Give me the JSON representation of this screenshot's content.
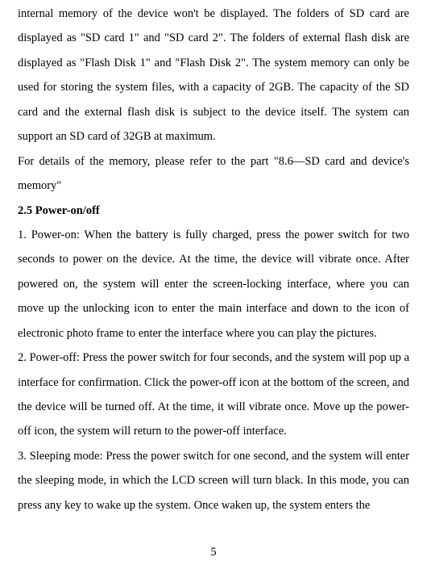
{
  "paragraphs": {
    "p1": "internal memory of the device won't be displayed. The folders of SD card are displayed as \"SD card 1\" and \"SD card 2\". The folders of external flash disk are displayed as \"Flash Disk 1\" and \"Flash Disk 2\". The system memory can only be used for storing the system files, with a capacity of 2GB. The capacity of the SD card and the external flash disk is subject to the device itself. The system can support an SD card of 32GB at maximum.",
    "p2": "For details of the memory, please refer to the part \"8.6—SD card and device's memory\"",
    "heading": "2.5 Power-on/off",
    "p3": "1. Power-on: When the battery is fully charged, press the power switch for two seconds to power on the device. At the time, the device will vibrate once. After powered on, the system will enter the screen-locking interface, where you can move up the unlocking icon to enter the main interface and down to the icon of electronic photo frame to enter the interface where you can play the pictures.",
    "p4": "2. Power-off: Press the power switch for four seconds, and the system will pop up a interface for confirmation. Click the power-off icon at the bottom of the screen, and the device will be turned off. At the time, it will vibrate once. Move up the power-off icon, the system will return to the power-off interface.",
    "p5": "3. Sleeping mode: Press the power switch for one second, and the system will enter the sleeping mode, in which the LCD screen will turn black. In this mode, you can press any key to wake up the system. Once waken up, the system enters the"
  },
  "pageNumber": "5"
}
